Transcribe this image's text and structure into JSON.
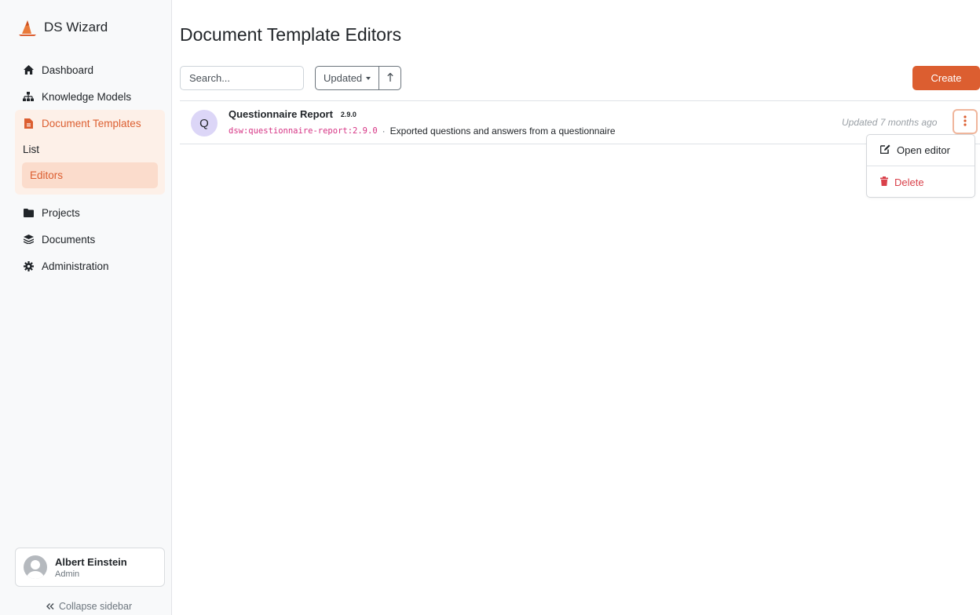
{
  "app": {
    "name": "DS Wizard",
    "brand_color": "#dc5e30"
  },
  "sidebar": {
    "items": [
      {
        "label": "Dashboard",
        "icon": "home-icon"
      },
      {
        "label": "Knowledge Models",
        "icon": "sitemap-icon"
      },
      {
        "label": "Document Templates",
        "icon": "file-icon",
        "active": true
      },
      {
        "label": "Projects",
        "icon": "folder-icon"
      },
      {
        "label": "Documents",
        "icon": "layers-icon"
      },
      {
        "label": "Administration",
        "icon": "gear-icon"
      }
    ],
    "subitems": [
      {
        "label": "List"
      },
      {
        "label": "Editors",
        "active": true
      }
    ],
    "user": {
      "name": "Albert Einstein",
      "role": "Admin"
    },
    "collapse_label": "Collapse sidebar"
  },
  "main": {
    "title": "Document Template Editors",
    "search_placeholder": "Search...",
    "sort_label": "Updated",
    "create_label": "Create",
    "rows": [
      {
        "initial": "Q",
        "name": "Questionnaire Report",
        "version": "2.9.0",
        "id": "dsw:questionnaire-report:2.9.0",
        "separator": "·",
        "description": "Exported questions and answers from a questionnaire",
        "updated": "Updated 7 months ago"
      }
    ],
    "dropdown": {
      "open_editor": "Open editor",
      "delete": "Delete"
    }
  }
}
